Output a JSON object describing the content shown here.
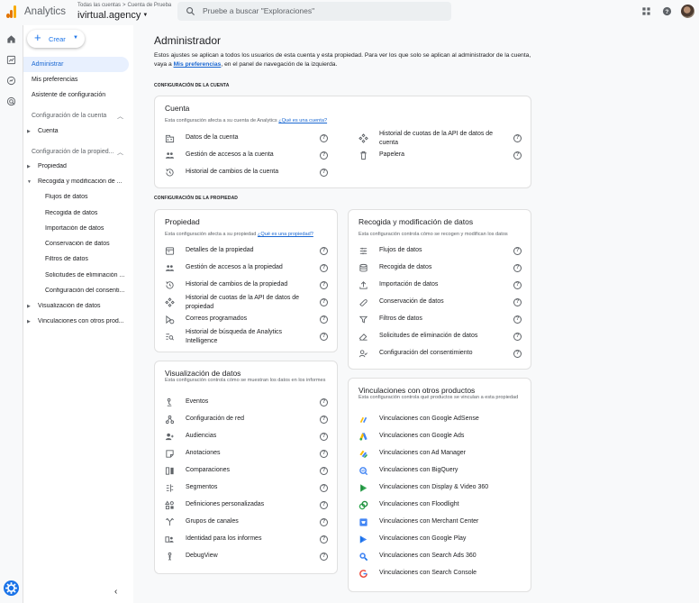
{
  "topbar": {
    "app_name": "Analytics",
    "breadcrumb": [
      "Todas las cuentas",
      "Cuenta de Prueba"
    ],
    "breadcrumb_sep": ">",
    "account": "ivirtual.agency",
    "search_placeholder": "Pruebe a buscar \"Exploraciones\""
  },
  "sidebar": {
    "create_label": "Crear",
    "items": [
      "Administrar",
      "Mis preferencias",
      "Asistente de configuración"
    ],
    "account_section": "Configuración de la cuenta",
    "account_items": [
      "Cuenta"
    ],
    "property_section": "Configuración de la propied...",
    "property_items": [
      "Propiedad",
      "Recogida y modificación de ..."
    ],
    "data_items": [
      "Flujos de datos",
      "Recogida de datos",
      "Importación de datos",
      "Conservación de datos",
      "Filtros de datos",
      "Solicitudes de eliminación ...",
      "Configuración del consenti..."
    ],
    "more_items": [
      "Visualización de datos",
      "Vinculaciones con otros prod..."
    ]
  },
  "main": {
    "title": "Administrador",
    "desc_1": "Estos ajustes se aplican a todos los usuarios de esta cuenta y esta propiedad. Para ver los que solo se aplican al administrador de la cuenta, vaya a ",
    "desc_link": "Mis preferencias",
    "desc_2": ", en el panel de navegación de la izquierda.",
    "account_section_label": "CONFIGURACIÓN DE LA CUENTA",
    "property_section_label": "CONFIGURACIÓN DE LA PROPIEDAD"
  },
  "cards": {
    "cuenta": {
      "title": "Cuenta",
      "sub": "Esta configuración afecta a su cuenta de Analytics",
      "sub_link": "¿Qué es una cuenta?",
      "left": [
        "Datos de la cuenta",
        "Gestión de accesos a la cuenta",
        "Historial de cambios de la cuenta"
      ],
      "right": [
        "Historial de cuotas de la API de datos de cuenta",
        "Papelera"
      ]
    },
    "propiedad": {
      "title": "Propiedad",
      "sub": "Esta configuración afecta a su propiedad",
      "sub_link": "¿Qué es una propiedad?",
      "rows": [
        "Detalles de la propiedad",
        "Gestión de accesos a la propiedad",
        "Historial de cambios de la propiedad",
        "Historial de cuotas de la API de datos de propiedad",
        "Correos programados",
        "Historial de búsqueda de Analytics Intelligence"
      ]
    },
    "recogida": {
      "title": "Recogida y modificación de datos",
      "sub": "Esta configuración controla cómo se recogen y modifican los datos",
      "rows": [
        "Flujos de datos",
        "Recogida de datos",
        "Importación de datos",
        "Conservación de datos",
        "Filtros de datos",
        "Solicitudes de eliminación de datos",
        "Configuración del consentimiento"
      ]
    },
    "visualizacion": {
      "title": "Visualización de datos",
      "sub": "Esta configuración controla cómo se muestran los datos en los informes",
      "rows": [
        "Eventos",
        "Configuración de red",
        "Audiencias",
        "Anotaciones",
        "Comparaciones",
        "Segmentos",
        "Definiciones personalizadas",
        "Grupos de canales",
        "Identidad para los informes",
        "DebugView"
      ]
    },
    "vinculaciones": {
      "title": "Vinculaciones con otros productos",
      "sub": "Esta configuración controla qué productos se vinculan a esta propiedad",
      "rows": [
        "Vinculaciones con Google AdSense",
        "Vinculaciones con Google Ads",
        "Vinculaciones con Ad Manager",
        "Vinculaciones con BigQuery",
        "Vinculaciones con Display & Video 360",
        "Vinculaciones con Floodlight",
        "Vinculaciones con Merchant Center",
        "Vinculaciones con Google Play",
        "Vinculaciones con Search Ads 360",
        "Vinculaciones con Search Console"
      ]
    }
  },
  "colors": {
    "accent": "#1a73e8",
    "active_bg": "#e8f0fe",
    "brand_orange": "#f9ab00"
  },
  "help_glyph": "?"
}
